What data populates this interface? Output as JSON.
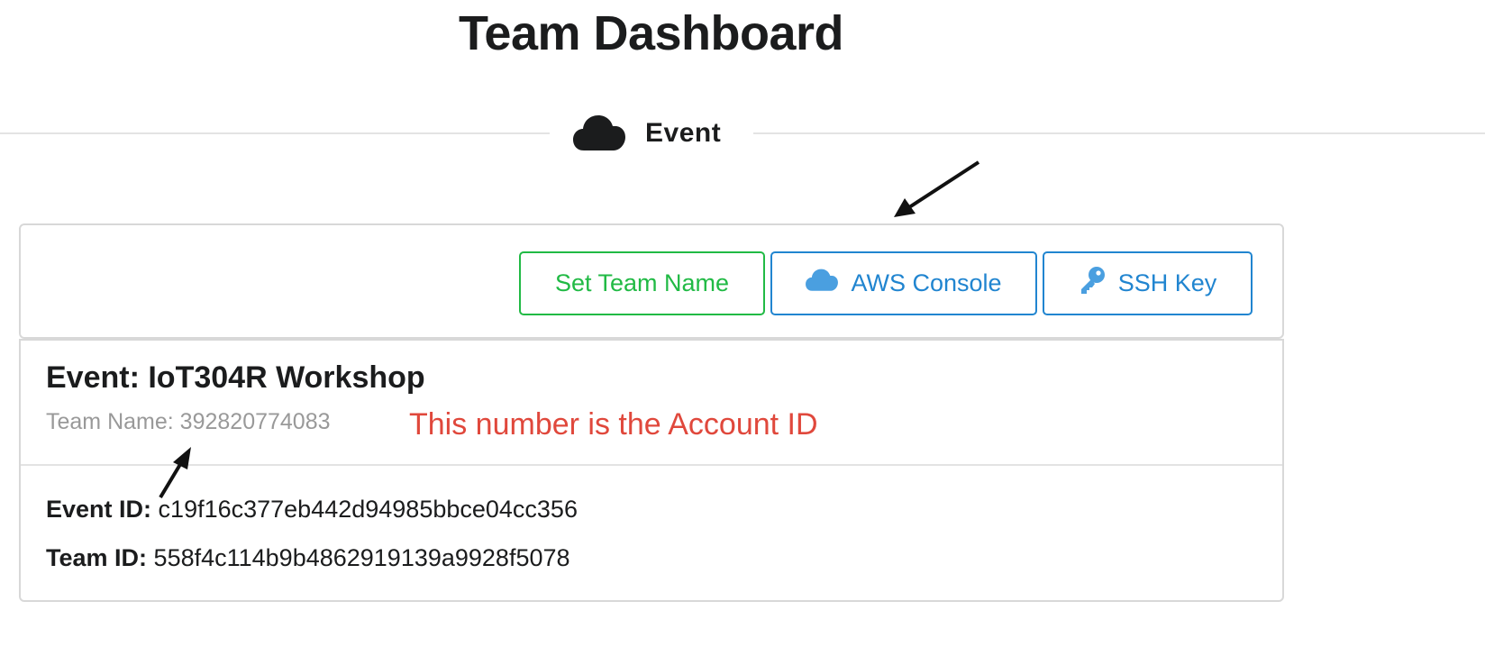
{
  "page": {
    "title": "Team Dashboard"
  },
  "section": {
    "label": "Event",
    "icon": "cloud-icon"
  },
  "toolbar": {
    "set_team_name_label": "Set Team Name",
    "aws_console_label": "AWS Console",
    "aws_console_icon": "cloud-icon",
    "ssh_key_label": "SSH Key",
    "ssh_key_icon": "key-icon"
  },
  "event": {
    "title": "Event: IoT304R Workshop",
    "team_name_label": "Team Name:",
    "team_name_value": "392820774083",
    "event_id_label": "Event ID:",
    "event_id_value": "c19f16c377eb442d94985bbce04cc356",
    "team_id_label": "Team ID:",
    "team_id_value": "558f4c114b9b4862919139a9928f5078"
  },
  "annotations": {
    "account_id_note": "This number is the Account ID"
  },
  "colors": {
    "green": "#21ba45",
    "blue": "#2185d0",
    "light_blue_icon": "#4a9fe0",
    "annotation_red": "#e0483c",
    "muted_text": "#999999",
    "border": "#d8d8d8"
  }
}
